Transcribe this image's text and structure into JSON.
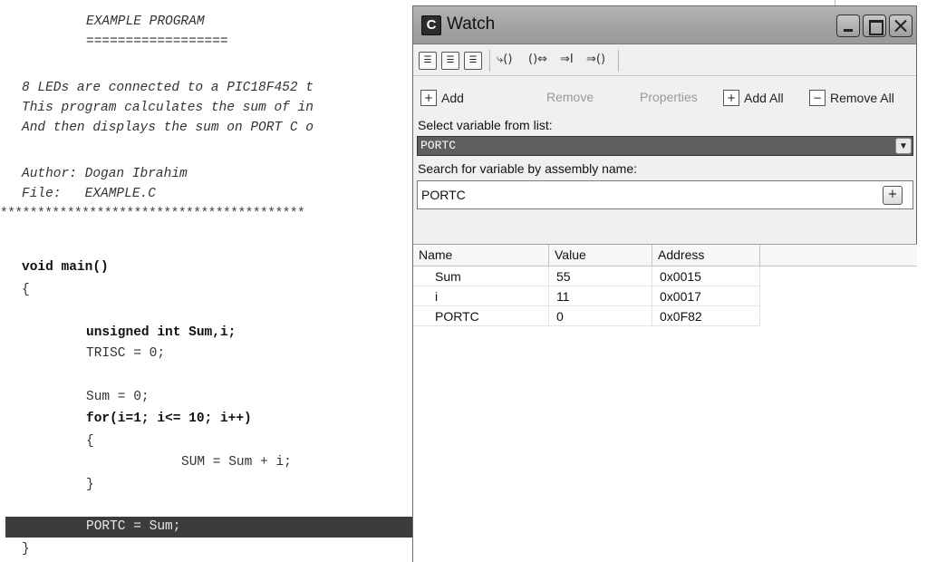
{
  "editor": {
    "header_title": "EXAMPLE PROGRAM",
    "header_underline": "==================",
    "comment_lines": [
      "8 LEDs are connected to a PIC18F452 t",
      "This program calculates the sum of in",
      "And then displays the sum on PORT C o"
    ],
    "author_line": "Author: Dogan Ibrahim",
    "file_line": "File:   EXAMPLE.C",
    "separator": "*****************************************",
    "code_lines": [
      "void main()",
      "{",
      "unsigned int Sum,i;",
      "TRISC = 0;",
      "Sum = 0;",
      "for(i=1; i<= 10; i++)",
      "{",
      "SUM = Sum + i;",
      "}",
      "PORTC = Sum;",
      "}"
    ]
  },
  "watch": {
    "title": "Watch",
    "app_icon": "C",
    "toolbar_icons": [
      "watch-add-icon",
      "watch-copy-icon",
      "watch-remove-icon",
      "step-into-icon",
      "step-over-icon",
      "run-to-cursor-icon",
      "step-out-icon"
    ],
    "toolbar_glyphs": [
      "⤷()",
      "()⇔",
      "⇒I",
      "⇒()"
    ],
    "actions": {
      "add": "Add",
      "remove": "Remove",
      "properties": "Properties",
      "add_all": "Add All",
      "remove_all": "Remove All"
    },
    "select_label": "Select variable from list:",
    "select_value": "PORTC",
    "search_label": "Search for variable by assembly name:",
    "search_value": "PORTC",
    "table": {
      "headers": [
        "Name",
        "Value",
        "Address"
      ],
      "rows": [
        {
          "name": "Sum",
          "value": "55",
          "address": "0x0015"
        },
        {
          "name": "i",
          "value": "11",
          "address": "0x0017"
        },
        {
          "name": "PORTC",
          "value": "0",
          "address": "0x0F82"
        }
      ]
    }
  }
}
